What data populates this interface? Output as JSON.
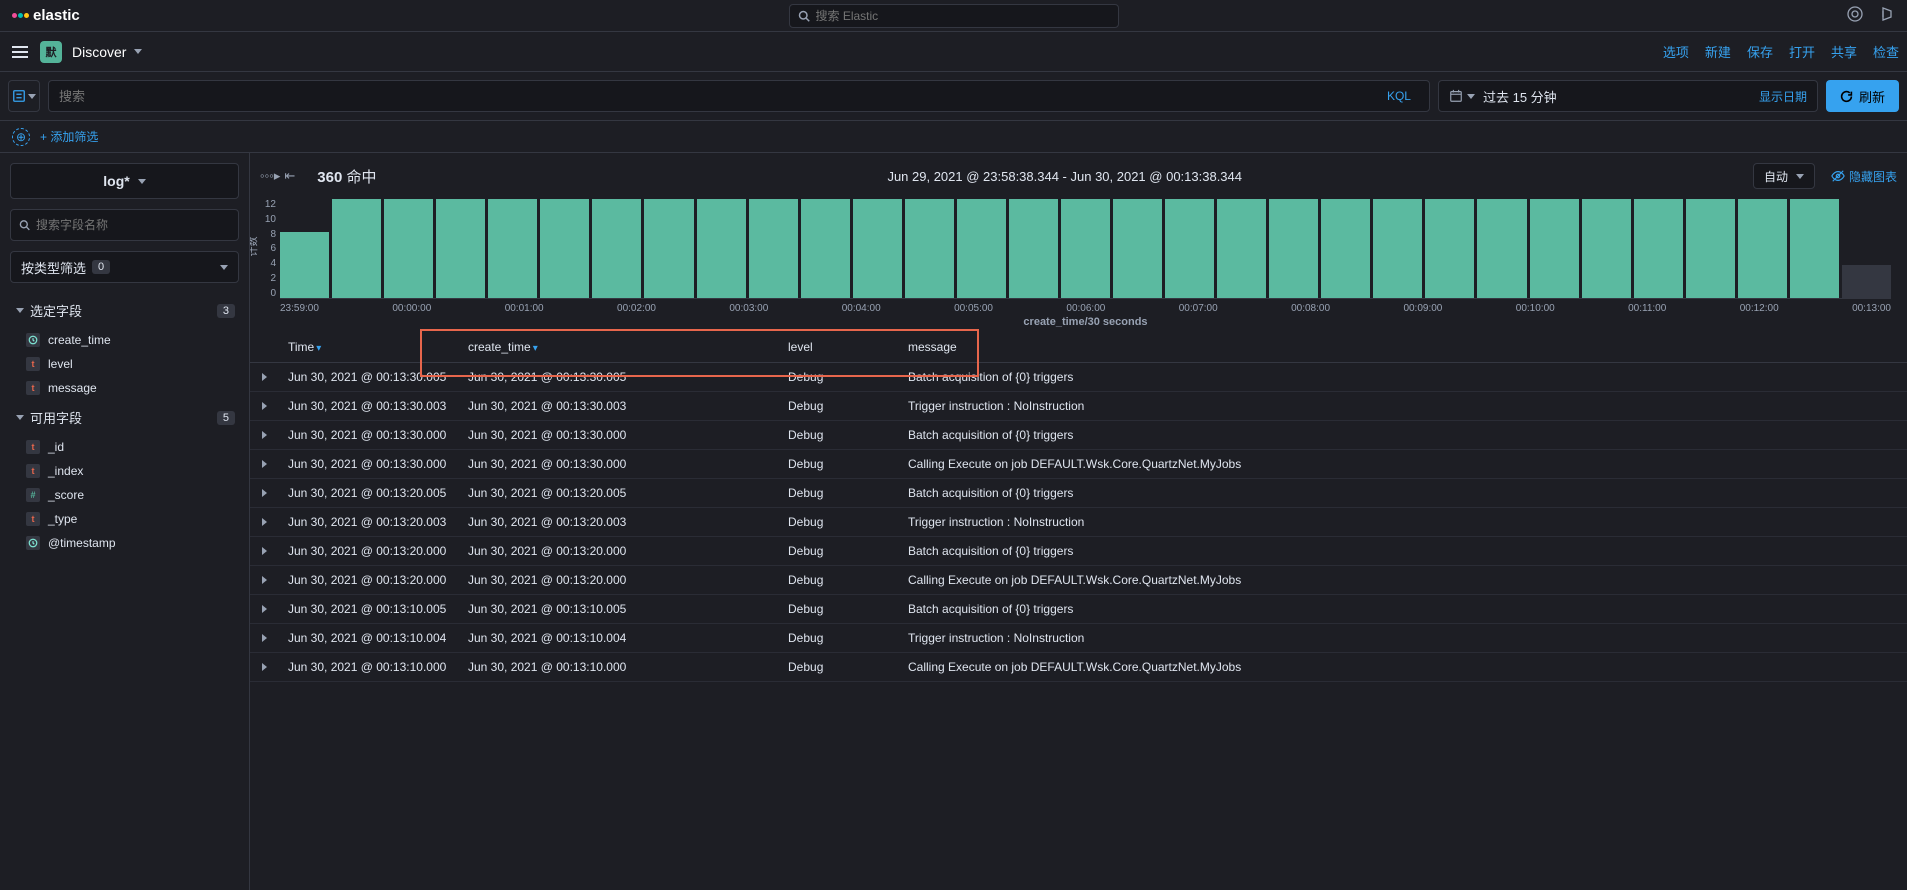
{
  "brand": "elastic",
  "global_search_placeholder": "搜索 Elastic",
  "nav": {
    "space_badge": "默",
    "title": "Discover",
    "links": [
      "选项",
      "新建",
      "保存",
      "打开",
      "共享",
      "检查"
    ]
  },
  "querybar": {
    "search_placeholder": "搜索",
    "kql": "KQL",
    "date_text": "过去 15 分钟",
    "show_date": "显示日期",
    "refresh": "刷新"
  },
  "filterbar": {
    "add": "+ 添加筛选"
  },
  "sidebar": {
    "index": "log*",
    "field_search_placeholder": "搜索字段名称",
    "type_filter": "按类型筛选",
    "type_filter_count": "0",
    "selected_label": "选定字段",
    "selected_count": "3",
    "selected_fields": [
      {
        "type": "clock",
        "name": "create_time"
      },
      {
        "type": "t",
        "name": "level"
      },
      {
        "type": "t",
        "name": "message"
      }
    ],
    "available_label": "可用字段",
    "available_count": "5",
    "available_fields": [
      {
        "type": "t",
        "name": "_id"
      },
      {
        "type": "t",
        "name": "_index"
      },
      {
        "type": "hash",
        "name": "_score"
      },
      {
        "type": "t",
        "name": "_type"
      },
      {
        "type": "clock",
        "name": "@timestamp"
      }
    ]
  },
  "hits": {
    "count": "360",
    "label": "命中"
  },
  "time_range": "Jun 29, 2021 @ 23:58:38.344 - Jun 30, 2021 @ 00:13:38.344",
  "interval": "自动",
  "hide_chart": "隐藏图表",
  "chart_data": {
    "type": "bar",
    "title": "",
    "xlabel": "create_time/30 seconds",
    "ylabel": "计数",
    "ylim": [
      0,
      12
    ],
    "yticks": [
      12,
      10,
      8,
      6,
      4,
      2,
      0
    ],
    "categories": [
      "23:59:00",
      "00:00:00",
      "00:01:00",
      "00:02:00",
      "00:03:00",
      "00:04:00",
      "00:05:00",
      "00:06:00",
      "00:07:00",
      "00:08:00",
      "00:09:00",
      "00:10:00",
      "00:11:00",
      "00:12:00",
      "00:13:00"
    ],
    "values": [
      8,
      12,
      12,
      12,
      12,
      12,
      12,
      12,
      12,
      12,
      12,
      12,
      12,
      12,
      12,
      12,
      12,
      12,
      12,
      12,
      12,
      12,
      12,
      12,
      12,
      12,
      12,
      12,
      12,
      12,
      4
    ]
  },
  "columns": [
    "Time",
    "create_time",
    "level",
    "message"
  ],
  "rows": [
    {
      "time": "Jun 30, 2021 @ 00:13:30.005",
      "create_time": "Jun 30, 2021 @ 00:13:30.005",
      "level": "Debug",
      "message": "Batch acquisition of {0} triggers"
    },
    {
      "time": "Jun 30, 2021 @ 00:13:30.003",
      "create_time": "Jun 30, 2021 @ 00:13:30.003",
      "level": "Debug",
      "message": "Trigger instruction : NoInstruction"
    },
    {
      "time": "Jun 30, 2021 @ 00:13:30.000",
      "create_time": "Jun 30, 2021 @ 00:13:30.000",
      "level": "Debug",
      "message": "Batch acquisition of {0} triggers"
    },
    {
      "time": "Jun 30, 2021 @ 00:13:30.000",
      "create_time": "Jun 30, 2021 @ 00:13:30.000",
      "level": "Debug",
      "message": "Calling Execute on job DEFAULT.Wsk.Core.QuartzNet.MyJobs"
    },
    {
      "time": "Jun 30, 2021 @ 00:13:20.005",
      "create_time": "Jun 30, 2021 @ 00:13:20.005",
      "level": "Debug",
      "message": "Batch acquisition of {0} triggers"
    },
    {
      "time": "Jun 30, 2021 @ 00:13:20.003",
      "create_time": "Jun 30, 2021 @ 00:13:20.003",
      "level": "Debug",
      "message": "Trigger instruction : NoInstruction"
    },
    {
      "time": "Jun 30, 2021 @ 00:13:20.000",
      "create_time": "Jun 30, 2021 @ 00:13:20.000",
      "level": "Debug",
      "message": "Batch acquisition of {0} triggers"
    },
    {
      "time": "Jun 30, 2021 @ 00:13:20.000",
      "create_time": "Jun 30, 2021 @ 00:13:20.000",
      "level": "Debug",
      "message": "Calling Execute on job DEFAULT.Wsk.Core.QuartzNet.MyJobs"
    },
    {
      "time": "Jun 30, 2021 @ 00:13:10.005",
      "create_time": "Jun 30, 2021 @ 00:13:10.005",
      "level": "Debug",
      "message": "Batch acquisition of {0} triggers"
    },
    {
      "time": "Jun 30, 2021 @ 00:13:10.004",
      "create_time": "Jun 30, 2021 @ 00:13:10.004",
      "level": "Debug",
      "message": "Trigger instruction : NoInstruction"
    },
    {
      "time": "Jun 30, 2021 @ 00:13:10.000",
      "create_time": "Jun 30, 2021 @ 00:13:10.000",
      "level": "Debug",
      "message": "Calling Execute on job DEFAULT.Wsk.Core.QuartzNet.MyJobs"
    }
  ]
}
